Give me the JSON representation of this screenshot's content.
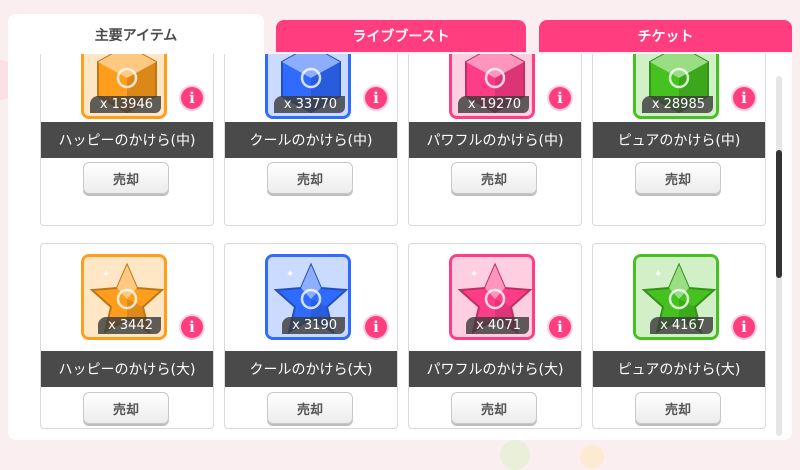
{
  "tabs": [
    {
      "label": "主要アイテム",
      "active": true
    },
    {
      "label": "ライブブースト",
      "active": false
    },
    {
      "label": "チケット",
      "active": false
    }
  ],
  "colors": {
    "accent_pink": "#ff3d7f",
    "name_bar": "#4a4a4a"
  },
  "rows": [
    {
      "shape": "hexagon",
      "items": [
        {
          "name": "ハッピーのかけら(中)",
          "count": "x 13946",
          "color": "#ff9d1c",
          "icon": "happy-shard-icon"
        },
        {
          "name": "クールのかけら(中)",
          "count": "x 33770",
          "color": "#2f6bff",
          "icon": "cool-shard-icon"
        },
        {
          "name": "パワフルのかけら(中)",
          "count": "x 19270",
          "color": "#ff3d87",
          "icon": "powerful-shard-icon"
        },
        {
          "name": "ピュアのかけら(中)",
          "count": "x 28985",
          "color": "#45c21f",
          "icon": "pure-shard-icon"
        }
      ]
    },
    {
      "shape": "star",
      "items": [
        {
          "name": "ハッピーのかけら(大)",
          "count": "x 3442",
          "color": "#ff9d1c",
          "icon": "happy-star-icon"
        },
        {
          "name": "クールのかけら(大)",
          "count": "x 3190",
          "color": "#2f6bff",
          "icon": "cool-star-icon"
        },
        {
          "name": "パワフルのかけら(大)",
          "count": "x 4071",
          "color": "#ff3d87",
          "icon": "powerful-star-icon"
        },
        {
          "name": "ピュアのかけら(大)",
          "count": "x 4167",
          "color": "#45c21f",
          "icon": "pure-star-icon"
        }
      ]
    }
  ],
  "sell_label": "売却",
  "info_label": "i"
}
